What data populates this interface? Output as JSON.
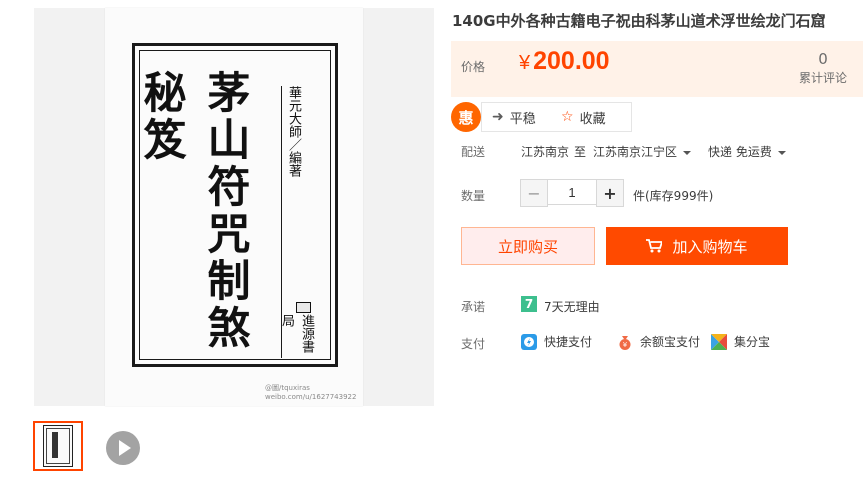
{
  "product": {
    "title": "140G中外各种古籍电子祝由科茅山道术浮世绘龙门石窟",
    "cover": {
      "title": "茅山符咒制煞秘笈",
      "author": "華元大師／編著",
      "publisher": "進源書局",
      "watermark_line1": "@圖/tquxiras",
      "watermark_line2": "weibo.com/u/1627743922"
    }
  },
  "price": {
    "label": "价格",
    "currency": "¥",
    "value": "200.00",
    "review_count": "0",
    "review_label": "累计评论"
  },
  "actions": {
    "hui": "惠",
    "stable": "平稳",
    "favorite": "收藏"
  },
  "shipping": {
    "label": "配送",
    "from": "江苏南京",
    "to_word": "至",
    "to": "江苏南京江宁区",
    "method": "快递 免运费"
  },
  "quantity": {
    "label": "数量",
    "minus": "−",
    "value": "1",
    "plus": "+",
    "stock": "件(库存999件)"
  },
  "buttons": {
    "buy_now": "立即购买",
    "add_to_cart": "加入购物车"
  },
  "promise": {
    "label": "承诺",
    "icon_text": "7",
    "text": "7天无理由"
  },
  "payment": {
    "label": "支付",
    "methods": [
      "快捷支付",
      "余额宝支付",
      "集分宝"
    ]
  },
  "colors": {
    "accent": "#ff4400",
    "price_bg": "#fff2e8",
    "cart_button": "#ff4a00",
    "promise_green": "#3dbf8e"
  }
}
